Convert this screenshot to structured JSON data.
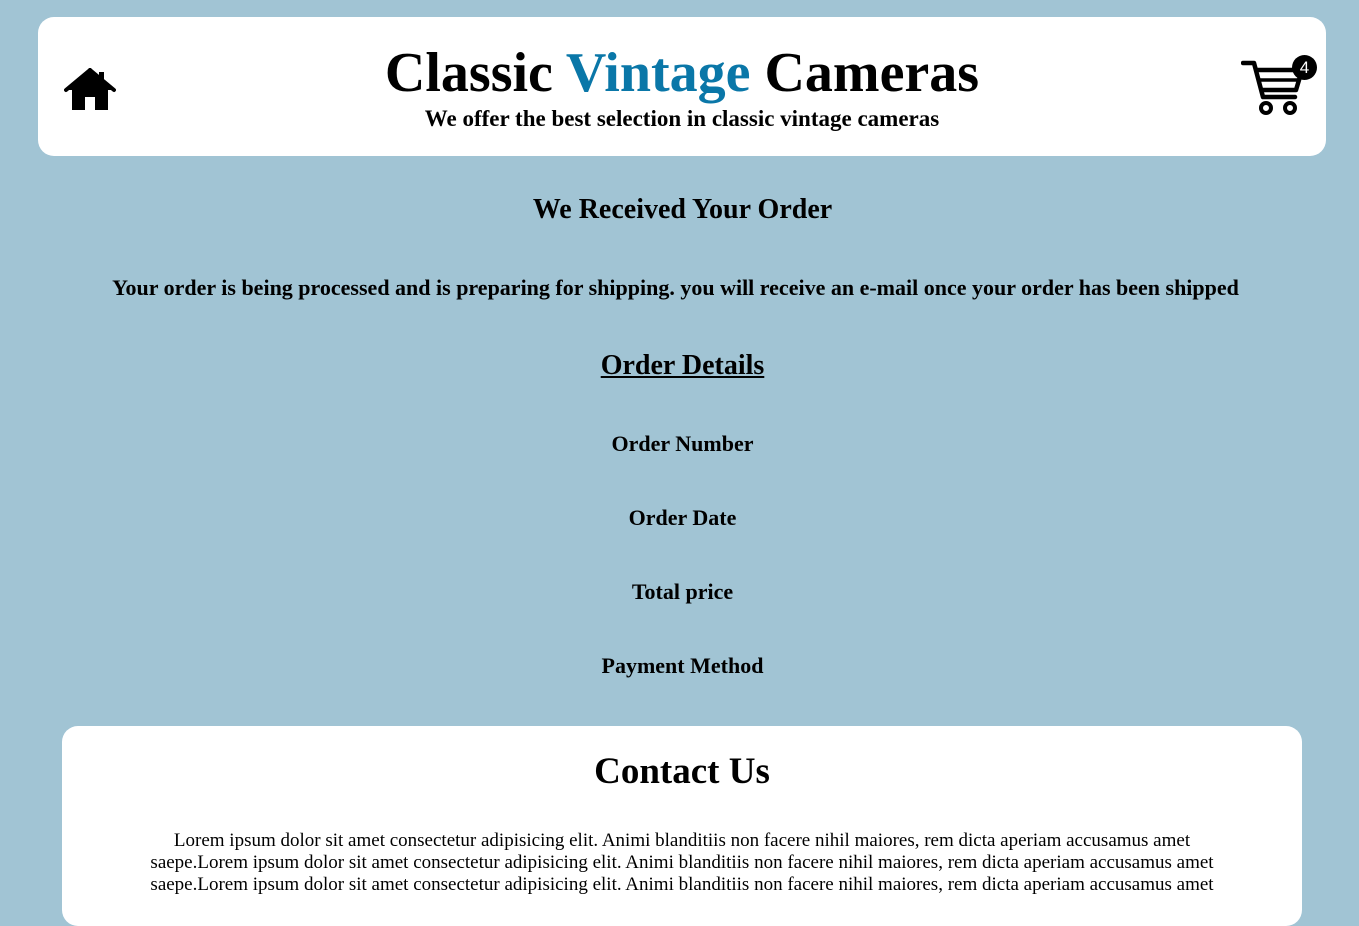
{
  "header": {
    "title_part1": "Classic ",
    "title_accent": "Vintage",
    "title_part2": " Cameras",
    "subtitle": "We offer the best selection in classic vintage cameras",
    "home_icon": "home-icon",
    "cart_icon": "cart-icon",
    "cart_count": "4",
    "accent_color": "#0a77a8"
  },
  "confirmation": {
    "heading": "We Received Your Order",
    "message": "Your order is being processed and is preparing for shipping. you will receive an e-mail once your order has been shipped"
  },
  "order_details": {
    "heading": "Order Details",
    "labels": [
      "Order Number",
      "Order Date",
      "Total price",
      "Payment Method"
    ]
  },
  "contact": {
    "title": "Contact Us",
    "body": "Lorem ipsum dolor sit amet consectetur adipisicing elit. Animi blanditiis non facere nihil maiores, rem dicta aperiam accusamus amet saepe.Lorem ipsum dolor sit amet consectetur adipisicing elit. Animi blanditiis non facere nihil maiores, rem dicta aperiam accusamus amet saepe.Lorem ipsum dolor sit amet consectetur adipisicing elit. Animi blanditiis non facere nihil maiores, rem dicta aperiam accusamus amet"
  },
  "colors": {
    "page_background": "#a1c4d4",
    "panel_background": "#ffffff"
  }
}
